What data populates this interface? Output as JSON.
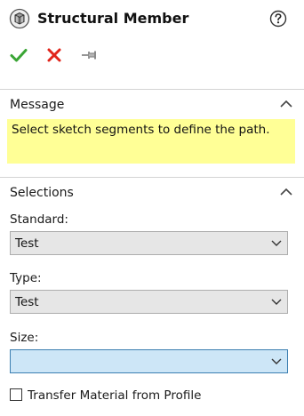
{
  "header": {
    "title": "Structural Member",
    "feature_icon": "structural-member-icon",
    "help_icon": "help-question-icon"
  },
  "actions": {
    "ok_icon": "checkmark-icon",
    "cancel_icon": "close-x-icon",
    "pin_icon": "pushpin-icon",
    "ok_color": "#3aa535",
    "cancel_color": "#e1251b"
  },
  "message": {
    "title": "Message",
    "text": "Select sketch segments to define the path.",
    "background": "#ffff96",
    "collapse_icon": "chevron-up-icon"
  },
  "selections": {
    "title": "Selections",
    "collapse_icon": "chevron-up-icon",
    "standard": {
      "label": "Standard:",
      "value": "Test"
    },
    "type": {
      "label": "Type:",
      "value": "Test"
    },
    "size": {
      "label": "Size:",
      "value": ""
    },
    "transfer_material": {
      "label": "Transfer Material from Profile",
      "checked": false
    }
  }
}
